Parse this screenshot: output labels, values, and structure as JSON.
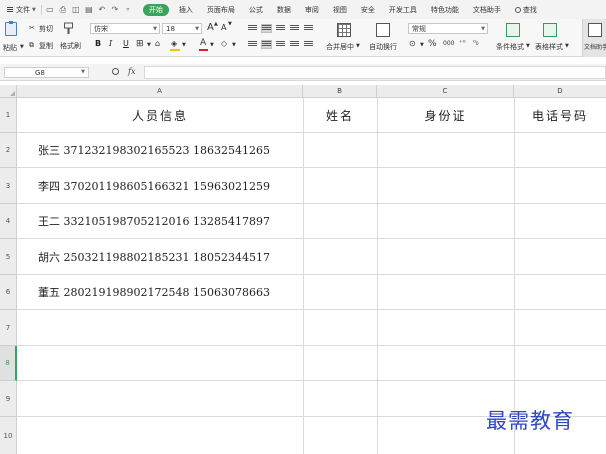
{
  "menubar": {
    "file_label": "文件",
    "tabs": [
      "开始",
      "插入",
      "页面布局",
      "公式",
      "数据",
      "审阅",
      "视图",
      "安全",
      "开发工具",
      "特色功能",
      "文档助手"
    ],
    "active_tab": "开始",
    "search_label": "查找",
    "active_color": "#3aa45a"
  },
  "ribbon": {
    "paste": "粘贴",
    "cut": "剪切",
    "copy": "复制",
    "format_painter": "格式刷",
    "font_name": "仿宋",
    "font_size": "18",
    "bold": "B",
    "italic": "I",
    "underline": "U",
    "merge_center": "合并居中",
    "wrap_text": "自动换行",
    "number_format": "常规",
    "percent": "%",
    "thousands": "000",
    "cond_format": "条件格式",
    "table_style": "表格样式",
    "doc_help": "文档助手",
    "grow_font": "A",
    "shrink_font": "A",
    "font_color_glyph": "A"
  },
  "formula_bar": {
    "cell_ref": "G8",
    "fx": "fx",
    "content": ""
  },
  "sheet": {
    "columns": [
      "A",
      "B",
      "C",
      "D"
    ],
    "rows": [
      "1",
      "2",
      "3",
      "4",
      "5",
      "6",
      "7",
      "8",
      "9",
      "10"
    ],
    "selected_row": "8",
    "header": {
      "a": "人员信息",
      "b": "姓名",
      "c": "身份证",
      "d": "电话号码"
    },
    "data": [
      "张三  371232198302165523  18632541265",
      "李四  370201198605166321  15963021259",
      "王二  332105198705212016  13285417897",
      "胡六  250321198802185231  18052344517",
      "董五  280219198902172548  15063078663"
    ]
  },
  "watermark": "最需教育"
}
